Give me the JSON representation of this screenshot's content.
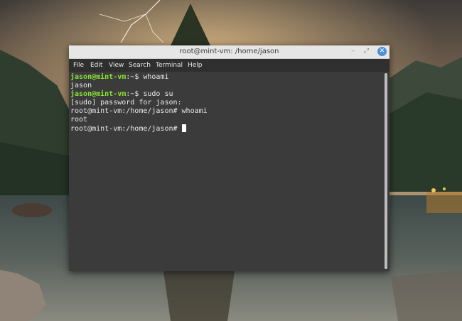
{
  "window": {
    "title": "root@mint-vm: /home/jason",
    "min_glyph": "–",
    "max_glyph": "⤢",
    "close_glyph": "✕"
  },
  "menu": {
    "file": "File",
    "edit": "Edit",
    "view": "View",
    "search": "Search",
    "terminal": "Terminal",
    "help": "Help"
  },
  "terminal": {
    "line1_user": "jason@mint-vm",
    "line1_path": ":~$ whoami",
    "line2": "jason",
    "line3_user": "jason@mint-vm",
    "line3_path": ":~$ sudo su",
    "line4": "[sudo] password for jason:",
    "line5": "root@mint-vm:/home/jason# whoami",
    "line6": "root",
    "line7": "root@mint-vm:/home/jason# "
  },
  "colors": {
    "prompt_green": "#8ae234",
    "terminal_bg": "#3b3b3b",
    "close_button_blue": "#4e8ed9"
  }
}
